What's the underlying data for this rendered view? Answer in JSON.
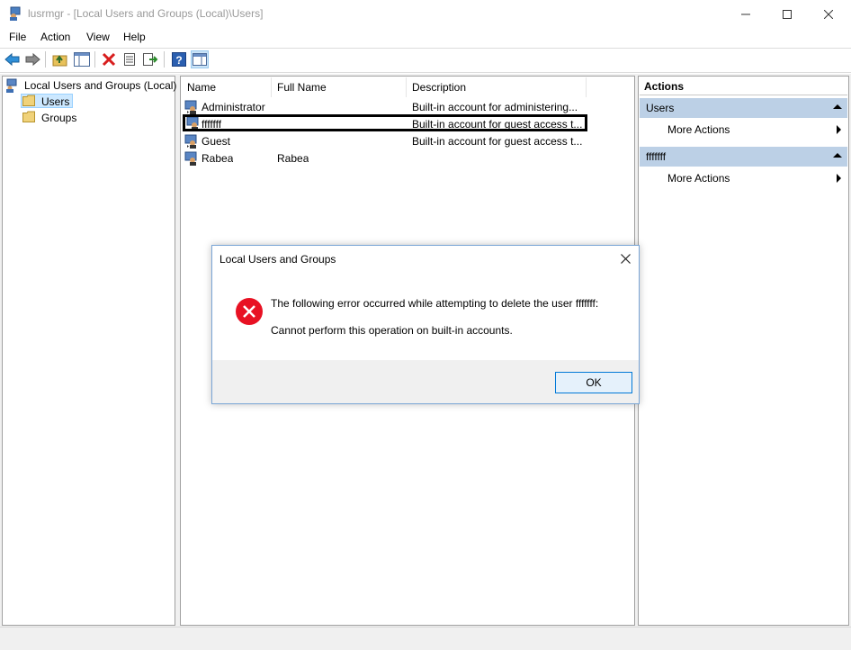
{
  "window": {
    "title": "lusrmgr - [Local Users and Groups (Local)\\Users]",
    "controls": {
      "minimize": "—",
      "maximize": "☐",
      "close": "✕"
    }
  },
  "menu": [
    "File",
    "Action",
    "View",
    "Help"
  ],
  "toolbar": {
    "icons": [
      "back-arrow-icon",
      "forward-arrow-icon",
      "up-folder-icon",
      "show-hide-tree-icon",
      "delete-icon",
      "properties-icon",
      "export-list-icon",
      "help-icon",
      "show-action-pane-icon"
    ]
  },
  "tree": {
    "root": "Local Users and Groups (Local)",
    "children": [
      "Users",
      "Groups"
    ],
    "selected": "Users"
  },
  "list": {
    "columns": [
      "Name",
      "Full Name",
      "Description"
    ],
    "rows": [
      {
        "name": "Administrator",
        "full_name": "",
        "description": "Built-in account for administering..."
      },
      {
        "name": "fffffff",
        "full_name": "",
        "description": "Built-in account for guest access t..."
      },
      {
        "name": "Guest",
        "full_name": "",
        "description": "Built-in account for guest access t..."
      },
      {
        "name": "Rabea",
        "full_name": "Rabea",
        "description": ""
      }
    ]
  },
  "actions": {
    "title": "Actions",
    "sections": [
      {
        "header": "Users",
        "link": "More Actions"
      },
      {
        "header": "fffffff",
        "link": "More Actions"
      }
    ]
  },
  "dialog": {
    "title": "Local Users and Groups",
    "close": "✕",
    "message_line1": "The following error occurred while attempting to delete the user fffffff:",
    "message_line2": "Cannot perform this operation on built-in accounts.",
    "ok_label": "OK",
    "error_color": "#e81123"
  }
}
